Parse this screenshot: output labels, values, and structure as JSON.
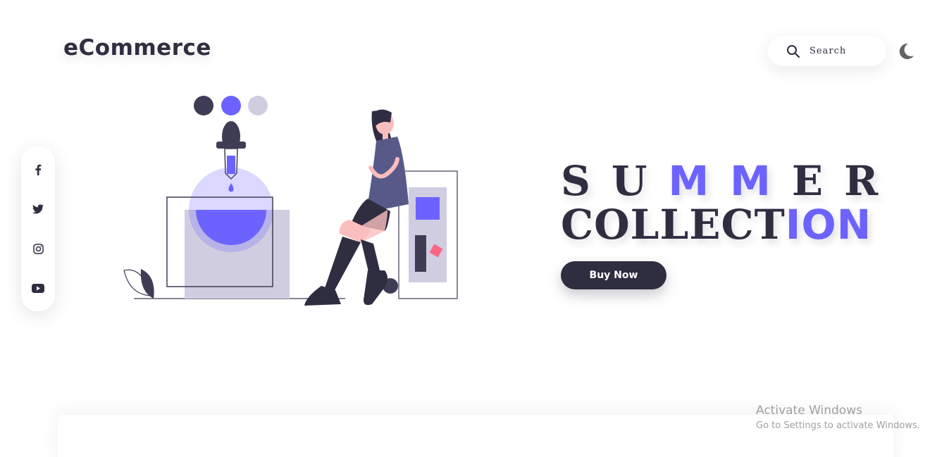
{
  "header": {
    "logo": "eCommerce",
    "search_placeholder": "Search"
  },
  "hero": {
    "title_line1_a": "SU",
    "title_line1_b": "MM",
    "title_line1_c": "ER",
    "title_line2_a": "COLLECT",
    "title_line2_b": "ION",
    "button_label": "Buy Now"
  },
  "social": {
    "icons": [
      "facebook-icon",
      "twitter-icon",
      "instagram-icon",
      "youtube-icon"
    ]
  },
  "watermark": {
    "title": "Activate Windows",
    "subtitle": "Go to Settings to activate Windows."
  },
  "colors": {
    "primary": "#2f2e41",
    "accent": "#6c63ff",
    "light": "#d0cde1",
    "pink": "#ff6584"
  }
}
